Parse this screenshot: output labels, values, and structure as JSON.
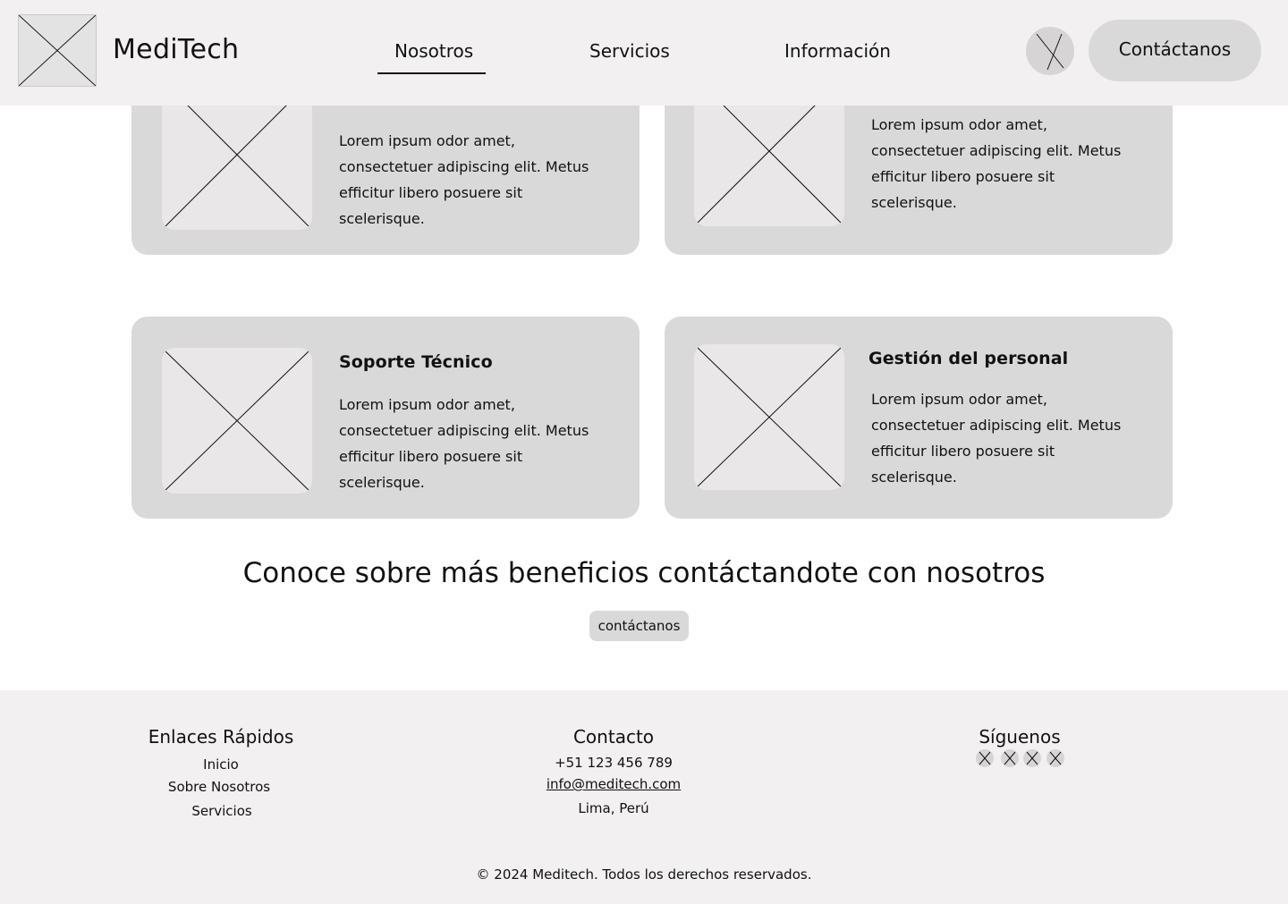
{
  "header": {
    "brand": "MediTech",
    "nav": [
      {
        "label": "Nosotros",
        "active": true
      },
      {
        "label": "Servicios",
        "active": false
      },
      {
        "label": "Información",
        "active": false
      }
    ],
    "cta_label": "Contáctanos"
  },
  "cards": [
    {
      "title": "",
      "description": "Lorem ipsum odor amet, consectetuer adipiscing elit. Metus efficitur libero posuere sit scelerisque."
    },
    {
      "title": "",
      "description": "Lorem ipsum odor amet, consectetuer adipiscing elit. Metus efficitur libero posuere sit scelerisque."
    },
    {
      "title": "Soporte Técnico",
      "description": "Lorem ipsum odor amet, consectetuer adipiscing elit. Metus efficitur libero posuere sit scelerisque."
    },
    {
      "title": "Gestión del personal",
      "description": "Lorem ipsum odor amet, consectetuer adipiscing elit. Metus efficitur libero posuere sit scelerisque."
    }
  ],
  "promo": {
    "heading": "Conoce sobre más beneficios contáctandote con nosotros",
    "button_label": "contáctanos"
  },
  "footer": {
    "links": {
      "heading": "Enlaces Rápidos",
      "items": [
        "Inicio",
        "Sobre Nosotros",
        "Servicios"
      ]
    },
    "contact": {
      "heading": "Contacto",
      "phone": "+51 123 456 789",
      "email": "info@meditech.com",
      "location": "Lima, Perú"
    },
    "social": {
      "heading": "Síguenos",
      "icons": [
        "social-icon",
        "social-icon",
        "social-icon",
        "social-icon"
      ]
    },
    "copyright": "© 2024 Meditech. Todos los derechos reservados."
  },
  "colors": {
    "header_bg": "#f2f0f1",
    "card_bg": "#d9d9d9",
    "placeholder_bg": "#e9e7e8",
    "button_bg": "#d9d9d9"
  }
}
